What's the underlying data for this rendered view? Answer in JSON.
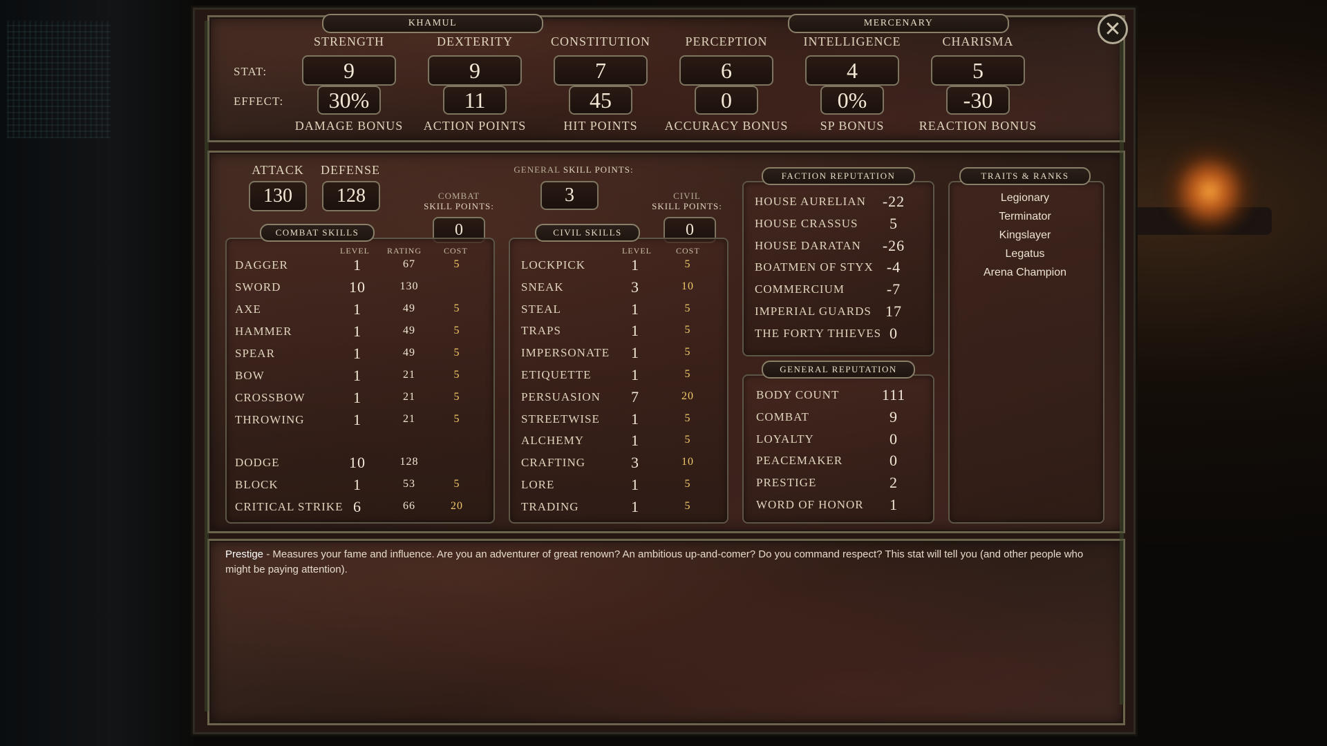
{
  "header": {
    "name": "KHAMUL",
    "class": "MERCENARY"
  },
  "stats": {
    "row_stat_label": "STAT:",
    "row_effect_label": "EFFECT:",
    "items": [
      {
        "name": "STRENGTH",
        "value": "9",
        "effect": "30%",
        "effect_label": "DAMAGE BONUS"
      },
      {
        "name": "DEXTERITY",
        "value": "9",
        "effect": "11",
        "effect_label": "ACTION POINTS"
      },
      {
        "name": "CONSTITUTION",
        "value": "7",
        "effect": "45",
        "effect_label": "HIT POINTS"
      },
      {
        "name": "PERCEPTION",
        "value": "6",
        "effect": "0",
        "effect_label": "ACCURACY BONUS"
      },
      {
        "name": "INTELLIGENCE",
        "value": "4",
        "effect": "0%",
        "effect_label": "SP BONUS"
      },
      {
        "name": "CHARISMA",
        "value": "5",
        "effect": "-30",
        "effect_label": "REACTION BONUS"
      }
    ]
  },
  "combat_summary": {
    "attack_label": "ATTACK",
    "attack": "130",
    "defense_label": "DEFENSE",
    "defense": "128"
  },
  "general_skill_points": {
    "label_prefix": "GENERAL",
    "label": "SKILL POINTS:",
    "value": "3"
  },
  "combat_skill_points": {
    "label_top": "COMBAT",
    "label": "SKILL POINTS:",
    "value": "0"
  },
  "civil_skill_points": {
    "label_top": "CIVIL",
    "label": "SKILL POINTS:",
    "value": "0"
  },
  "combat_skills": {
    "title": "COMBAT SKILLS",
    "headers": {
      "level": "LEVEL",
      "rating": "RATING",
      "cost": "COST"
    },
    "rows": [
      {
        "name": "DAGGER",
        "level": "1",
        "rating": "67",
        "cost": "5"
      },
      {
        "name": "SWORD",
        "level": "10",
        "rating": "130",
        "cost": ""
      },
      {
        "name": "AXE",
        "level": "1",
        "rating": "49",
        "cost": "5"
      },
      {
        "name": "HAMMER",
        "level": "1",
        "rating": "49",
        "cost": "5"
      },
      {
        "name": "SPEAR",
        "level": "1",
        "rating": "49",
        "cost": "5"
      },
      {
        "name": "BOW",
        "level": "1",
        "rating": "21",
        "cost": "5"
      },
      {
        "name": "CROSSBOW",
        "level": "1",
        "rating": "21",
        "cost": "5"
      },
      {
        "name": "THROWING",
        "level": "1",
        "rating": "21",
        "cost": "5"
      },
      {
        "name": "DODGE",
        "level": "10",
        "rating": "128",
        "cost": ""
      },
      {
        "name": "BLOCK",
        "level": "1",
        "rating": "53",
        "cost": "5"
      },
      {
        "name": "CRITICAL STRIKE",
        "level": "6",
        "rating": "66",
        "cost": "20"
      }
    ]
  },
  "civil_skills": {
    "title": "CIVIL SKILLS",
    "headers": {
      "level": "LEVEL",
      "cost": "COST"
    },
    "rows": [
      {
        "name": "LOCKPICK",
        "level": "1",
        "cost": "5"
      },
      {
        "name": "SNEAK",
        "level": "3",
        "cost": "10"
      },
      {
        "name": "STEAL",
        "level": "1",
        "cost": "5"
      },
      {
        "name": "TRAPS",
        "level": "1",
        "cost": "5"
      },
      {
        "name": "IMPERSONATE",
        "level": "1",
        "cost": "5"
      },
      {
        "name": "ETIQUETTE",
        "level": "1",
        "cost": "5"
      },
      {
        "name": "PERSUASION",
        "level": "7",
        "cost": "20"
      },
      {
        "name": "STREETWISE",
        "level": "1",
        "cost": "5"
      },
      {
        "name": "ALCHEMY",
        "level": "1",
        "cost": "5"
      },
      {
        "name": "CRAFTING",
        "level": "3",
        "cost": "10"
      },
      {
        "name": "LORE",
        "level": "1",
        "cost": "5"
      },
      {
        "name": "TRADING",
        "level": "1",
        "cost": "5"
      }
    ]
  },
  "faction_reputation": {
    "title": "FACTION REPUTATION",
    "rows": [
      {
        "name": "HOUSE AURELIAN",
        "value": "-22"
      },
      {
        "name": "HOUSE CRASSUS",
        "value": "5"
      },
      {
        "name": "HOUSE DARATAN",
        "value": "-26"
      },
      {
        "name": "BOATMEN OF STYX",
        "value": "-4"
      },
      {
        "name": "COMMERCIUM",
        "value": "-7"
      },
      {
        "name": "IMPERIAL GUARDS",
        "value": "17"
      },
      {
        "name": "THE FORTY THIEVES",
        "value": "0"
      }
    ]
  },
  "general_reputation": {
    "title": "GENERAL REPUTATION",
    "rows": [
      {
        "name": "BODY COUNT",
        "value": "111"
      },
      {
        "name": "COMBAT",
        "value": "9"
      },
      {
        "name": "LOYALTY",
        "value": "0"
      },
      {
        "name": "PEACEMAKER",
        "value": "0"
      },
      {
        "name": "PRESTIGE",
        "value": "2"
      },
      {
        "name": "WORD OF HONOR",
        "value": "1"
      }
    ]
  },
  "traits": {
    "title": "TRAITS & RANKS",
    "items": [
      "Legionary",
      "Terminator",
      "Kingslayer",
      "Legatus",
      "Arena Champion"
    ]
  },
  "description": {
    "term": "Prestige",
    "text": " - Measures your fame and influence. Are you an adventurer of great renown? An ambitious up-and-comer? Do you command respect? This stat will tell you (and other people who might be paying attention)."
  }
}
